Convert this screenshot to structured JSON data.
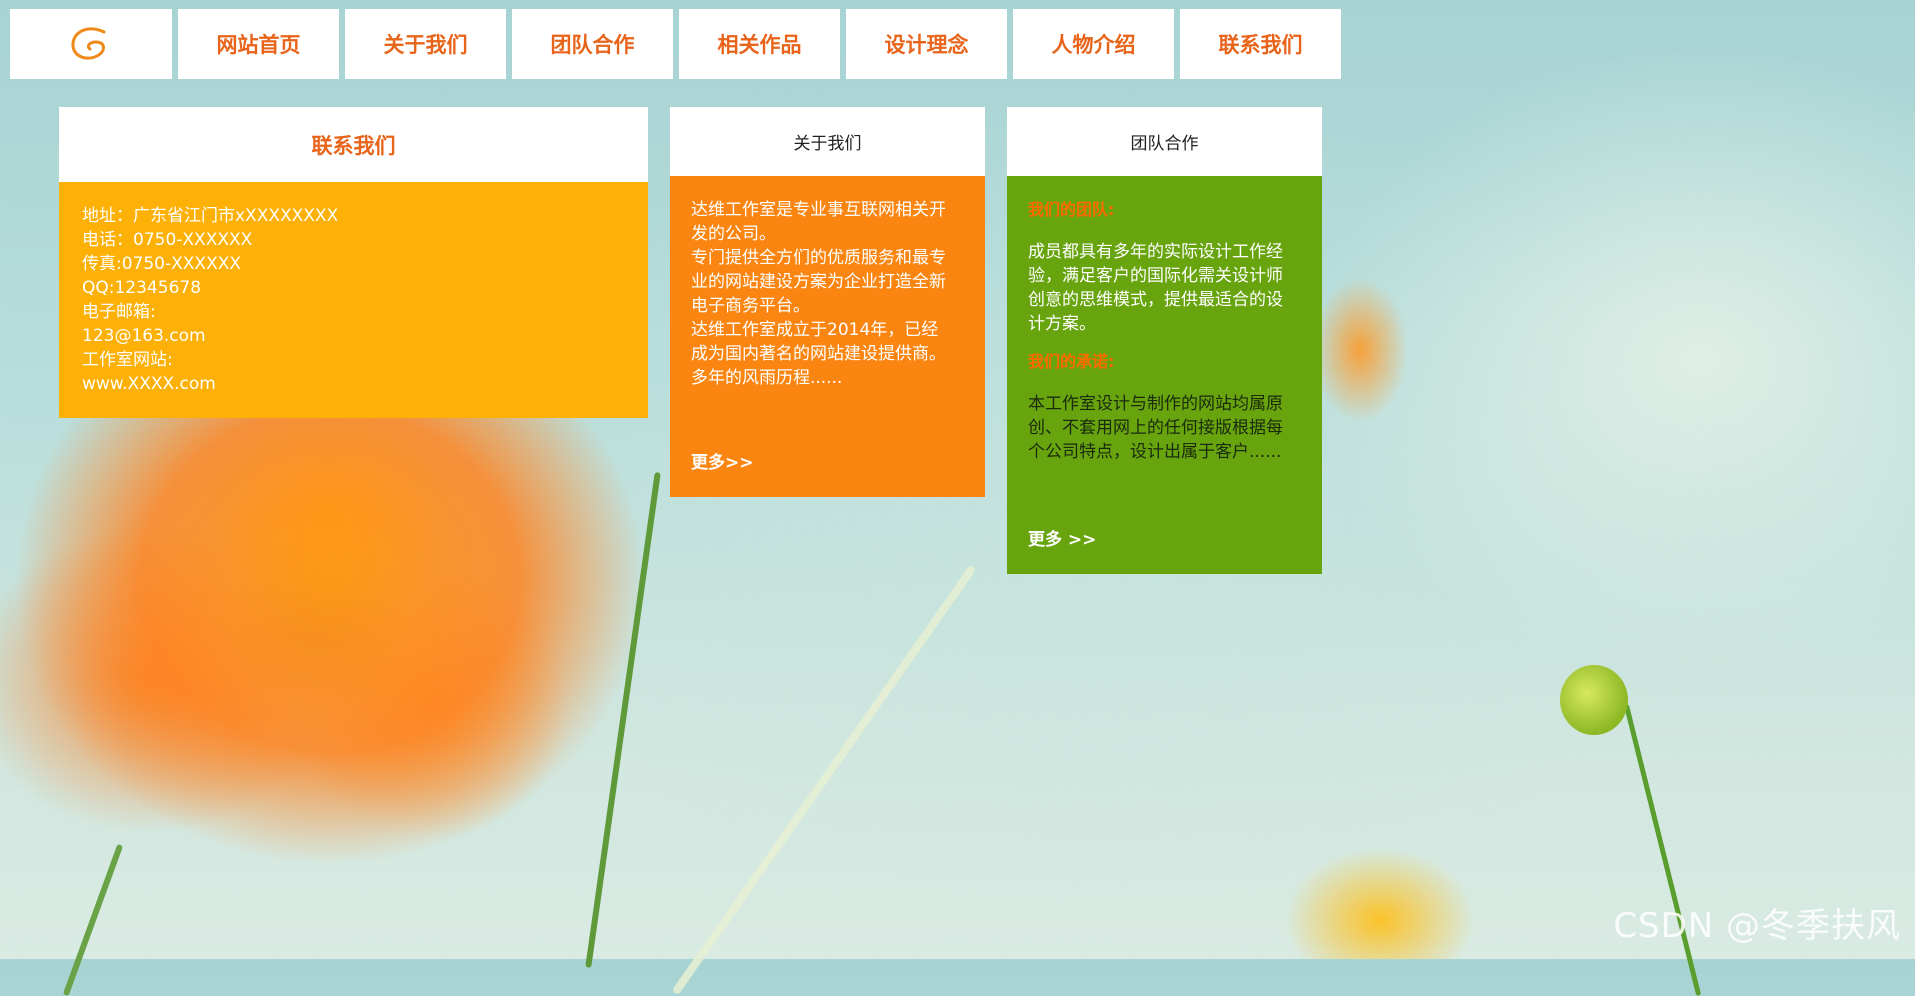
{
  "nav": {
    "logo_icon": "swirl-logo-icon",
    "items": [
      "网站首页",
      "关于我们",
      "团队合作",
      "相关作品",
      "设计理念",
      "人物介绍",
      "联系我们"
    ]
  },
  "contact": {
    "title": "联系我们",
    "lines": [
      "地址：广东省江门市xXXXXXXXX",
      "电话：0750-XXXXXX",
      "传真:0750-XXXXXX",
      "QQ:12345678",
      "电子邮箱:",
      "123@163.com",
      "工作室网站:",
      "www.XXXX.com"
    ]
  },
  "about": {
    "title": "关于我们",
    "text_lines": [
      "达维工作室是专业事互联网相关开",
      "发的公司。",
      "专门提供全方们的优质服务和最专",
      "业的网站建设方案为企业打造全新",
      "电子商务平台。",
      "达维工作室成立于2014年，已经",
      "成为国内著名的网站建设提供商。",
      "多年的风雨历程......"
    ],
    "more": "更多>>"
  },
  "team": {
    "title": "团队合作",
    "sub1": "我们的团队:",
    "text1_lines": [
      "成员都具有多年的实际设计工作经",
      "验，满足客户的国际化需关设计师",
      "创意的思维模式，提供最适合的设",
      "计方案。"
    ],
    "sub2": "我们的承诺:",
    "text2_lines": [
      "本工作室设计与制作的网站均属原",
      "创、不套用网上的任何接版根据每",
      "个公司特点，设计出属于客户......"
    ],
    "more": "更多 >>"
  },
  "watermark": "CSDN @冬季扶风",
  "colors": {
    "accent_orange_text": "#e8641b",
    "contact_bg": "#fdb005",
    "about_bg": "#fb8511",
    "team_bg": "#67a40e"
  }
}
